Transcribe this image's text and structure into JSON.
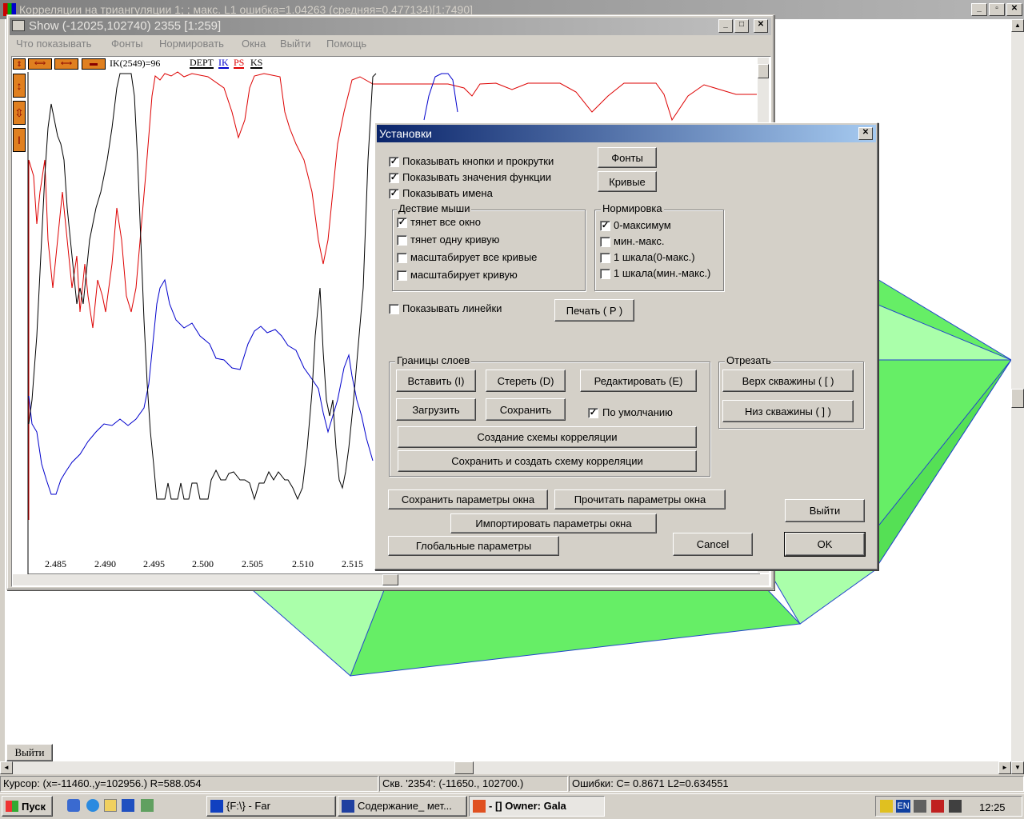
{
  "main_window": {
    "title": "Корреляции на триангуляции 1; ; макс. L1 ошибка=1.04263 (средняя=0.477134)[1:7490]",
    "exit_button": "Выйти"
  },
  "show_window": {
    "title": "Show (-12025,102740) 2355 [1:259]",
    "menu": [
      "Что показывать",
      "Фонты",
      "Нормировать",
      "Окна",
      "Выйти",
      "Помощь"
    ],
    "value_readout": "IK(2549)=96",
    "curves": [
      {
        "name": "DEPT",
        "color": "#000000"
      },
      {
        "name": "IK",
        "color": "#0000cc"
      },
      {
        "name": "PS",
        "color": "#dd0000"
      },
      {
        "name": "KS",
        "color": "#000000"
      }
    ],
    "x_ticks": [
      "2.485",
      "2.490",
      "2.495",
      "2.500",
      "2.505",
      "2.510",
      "2.515"
    ]
  },
  "dialog": {
    "title": "Установки",
    "checks_top": [
      {
        "label": "Показывать кнопки и прокрутки",
        "checked": true
      },
      {
        "label": "Показывать значения функции",
        "checked": true
      },
      {
        "label": "Показывать имена",
        "checked": true
      }
    ],
    "fonts_button": "Фонты",
    "curves_button": "Кривые",
    "mouse_group": {
      "title": "Дествие мыши",
      "items": [
        {
          "label": "тянет все окно",
          "checked": true
        },
        {
          "label": "тянет одну кривую",
          "checked": false
        },
        {
          "label": "масштабирует все кривые",
          "checked": false
        },
        {
          "label": "масштабирует кривую",
          "checked": false
        }
      ]
    },
    "norm_group": {
      "title": "Нормировка",
      "items": [
        {
          "label": "0-максимум",
          "checked": true
        },
        {
          "label": "мин.-макс.",
          "checked": false
        },
        {
          "label": "1 шкала(0-макс.)",
          "checked": false
        },
        {
          "label": "1 шкала(мин.-макс.)",
          "checked": false
        }
      ]
    },
    "rulers": {
      "label": "Показывать линейки",
      "checked": false
    },
    "print_button": "Печать ( P )",
    "layers_group": {
      "title": "Границы слоев",
      "insert": "Вставить (I)",
      "erase": "Стереть (D)",
      "edit": "Редактировать (E)",
      "load": "Загрузить",
      "save": "Сохранить",
      "default_label": "По умолчанию",
      "default_checked": true,
      "create_scheme": "Создание схемы корреляции",
      "save_create_scheme": "Сохранить и создать схему корреляции"
    },
    "cut_group": {
      "title": "Отрезать",
      "top": "Верх скважины  ( [ )",
      "bottom": "Низ скважины  ( ] )"
    },
    "save_params": "Сохранить параметры окна",
    "read_params": "Прочитать параметры окна",
    "import_params": "Импортировать параметры окна",
    "global_params": "Глобальные параметры",
    "exit": "Выйти",
    "cancel": "Cancel",
    "ok": "OK"
  },
  "status_bar": {
    "cursor": "Курсор: (x=-11460.,y=102956.) R=588.054",
    "well": "Скв. '2354': (-11650., 102700.)",
    "errors": "Ошибки: C=  0.8671 L2=0.634551"
  },
  "taskbar": {
    "start": "Пуск",
    "tasks": [
      "{F:\\} - Far",
      "Содержание_ мет...",
      "- [] Owner: Gala"
    ],
    "lang": "EN",
    "clock": "12:25"
  }
}
